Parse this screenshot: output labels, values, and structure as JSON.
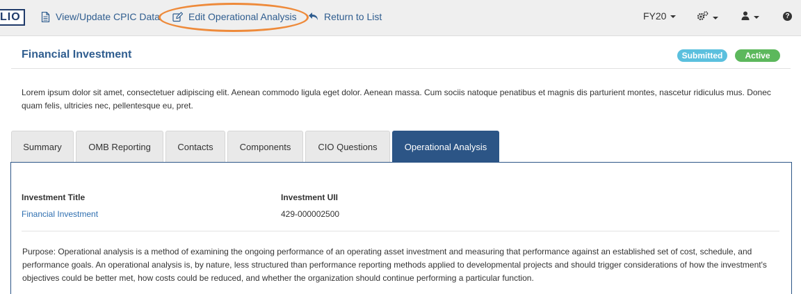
{
  "topbar": {
    "logo_text": "LIO",
    "view_update_label": "View/Update CPIC Data",
    "edit_analysis_label": "Edit Operational Analysis",
    "return_label": "Return to List",
    "fiscal_year": "FY20",
    "accent_color": "#2f5d8f",
    "highlight_color": "#ee8a3a"
  },
  "header": {
    "title": "Financial Investment",
    "badges": [
      {
        "label": "Submitted",
        "color": "#5bc0de"
      },
      {
        "label": "Active",
        "color": "#5cb85c"
      }
    ],
    "description": "Lorem ipsum dolor sit amet, consectetuer adipiscing elit. Aenean commodo ligula eget dolor. Aenean massa. Cum sociis natoque penatibus et magnis dis parturient montes, nascetur ridiculus mus. Donec quam felis, ultricies nec, pellentesque eu, pret."
  },
  "tabs": [
    {
      "label": "Summary",
      "active": false
    },
    {
      "label": "OMB Reporting",
      "active": false
    },
    {
      "label": "Contacts",
      "active": false
    },
    {
      "label": "Components",
      "active": false
    },
    {
      "label": "CIO Questions",
      "active": false
    },
    {
      "label": "Operational Analysis",
      "active": true
    }
  ],
  "panel": {
    "investment_title_label": "Investment Title",
    "investment_title_value": "Financial Investment",
    "investment_uii_label": "Investment UII",
    "investment_uii_value": "429-000002500",
    "purpose": "Purpose: Operational analysis is a method of examining the ongoing performance of an operating asset investment and measuring that performance against an established set of cost, schedule, and performance goals. An operational analysis is, by nature, less structured than performance reporting methods applied to developmental projects and should trigger considerations of how the investment's objectives could be better met, how costs could be reduced, and whether the organization should continue performing a particular function."
  },
  "icons": {
    "view_update": "document-icon",
    "edit": "edit-icon",
    "return": "return-arrow-icon",
    "settings": "gears-icon",
    "user": "user-icon",
    "help": "help-icon"
  }
}
